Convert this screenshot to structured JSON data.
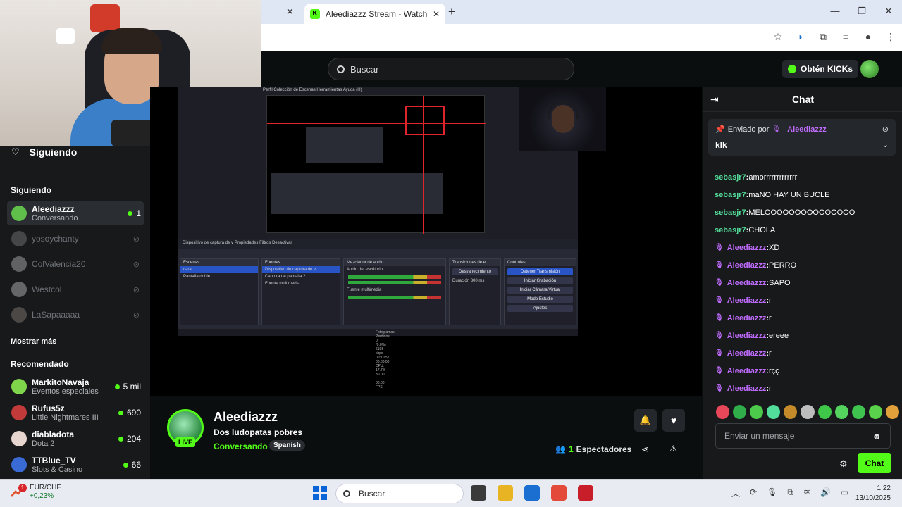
{
  "browser": {
    "tab_title": "Aleediazzz Stream - Watch Live",
    "tab_close": "✕",
    "prev_tab_close": "✕",
    "new_tab": "+",
    "window_controls": [
      "—",
      "❐",
      "✕"
    ],
    "toolbar_icons": [
      "star-icon",
      "audio-icon",
      "extensions-icon",
      "playlist-icon",
      "profile-icon",
      "menu-icon"
    ]
  },
  "header": {
    "search_placeholder": "Buscar",
    "kicks_label": "Obtén KICKs"
  },
  "sidebar": {
    "following_title": "Siguiendo",
    "following_section": "Siguiendo",
    "following": [
      {
        "name": "Aleediazzz",
        "sub": "Conversando",
        "viewers": "1",
        "live": true,
        "color": "#5fbf4a"
      },
      {
        "name": "yosoychanty",
        "sub": "",
        "viewers": "",
        "live": false,
        "color": "#8a8a8a"
      },
      {
        "name": "ColValencia20",
        "sub": "",
        "viewers": "",
        "live": false,
        "color": "#cfcfcf"
      },
      {
        "name": "Westcol",
        "sub": "",
        "viewers": "",
        "live": false,
        "color": "#d9d9d9"
      },
      {
        "name": "LaSapaaaaa",
        "sub": "",
        "viewers": "",
        "live": false,
        "color": "#9a8f85"
      }
    ],
    "show_more": "Mostrar más",
    "recommended_section": "Recomendado",
    "recommended": [
      {
        "name": "MarkitoNavaja",
        "sub": "Eventos especiales",
        "viewers": "5 mil",
        "color": "#7fd64a"
      },
      {
        "name": "Rufus5z",
        "sub": "Little Nightmares III",
        "viewers": "690",
        "color": "#c23a3a"
      },
      {
        "name": "diabladota",
        "sub": "Dota 2",
        "viewers": "204",
        "color": "#e6d6cf"
      },
      {
        "name": "TTBlue_TV",
        "sub": "Slots & Casino",
        "viewers": "66",
        "color": "#3a6ad6"
      }
    ]
  },
  "stream": {
    "streamer": "Aleediazzz",
    "title": "Dos ludopatas pobres",
    "category": "Conversando",
    "language": "Spanish",
    "live_badge": "LIVE",
    "viewer_count": "1",
    "viewer_label": "Espectadores"
  },
  "obs": {
    "menu": "Perfil    Colección de Escenas    Herramientas    Ayuda (H)",
    "toolbar": "Dispositivo de captura de v    Propiedades    Filtros    Desactivar",
    "panels": {
      "scenes_title": "Escenas",
      "scenes": [
        "cara",
        "Pantalla doble"
      ],
      "sources_title": "Fuentes",
      "sources": [
        "Dispositivo de captura de vi",
        "Captura de pantalla 2",
        "Fuente multimedia"
      ],
      "mixer_title": "Mezclador de audio",
      "mixer": [
        "Audio del escritorio",
        "Fuente multimedia"
      ],
      "transitions_title": "Transiciones de e...",
      "transition": "Desvanecimiento",
      "duration_label": "Duración",
      "duration": "300 ms",
      "controls_title": "Controles",
      "controls": [
        "Detener Transmisión",
        "Iniciar Grabación",
        "Iniciar Cámara Virtual",
        "Modo Estudio",
        "Ajustes"
      ]
    },
    "status": "Fotogramas Perdidos 0 (0.0%)   6198 kbps   00:10:52   00:00:00   CPU: 17.7%   30.00 / 30.00 FPS"
  },
  "chat": {
    "title": "Chat",
    "pinned_by_label": "Enviado por",
    "pinned_by": "Aleediazzz",
    "pinned_message": "klk",
    "messages": [
      {
        "user": "sebasjr7",
        "text": "amorrrrrrrrrrrrr",
        "color": "#53dd9a",
        "mic": false
      },
      {
        "user": "sebasjr7",
        "text": "maNO HAY UN BUCLE",
        "color": "#53dd9a",
        "mic": false
      },
      {
        "user": "sebasjr7",
        "text": "MELOOOOOOOOOOOOOOO",
        "color": "#53dd9a",
        "mic": false
      },
      {
        "user": "sebasjr7",
        "text": "CHOLA",
        "color": "#53dd9a",
        "mic": false
      },
      {
        "user": "Aleediazzz",
        "text": "XD",
        "color": "#c06cff",
        "mic": true
      },
      {
        "user": "Aleediazzz",
        "text": "PERRO",
        "color": "#c06cff",
        "mic": true
      },
      {
        "user": "Aleediazzz",
        "text": "SAPO",
        "color": "#c06cff",
        "mic": true
      },
      {
        "user": "Aleediazzz",
        "text": "r",
        "color": "#c06cff",
        "mic": true
      },
      {
        "user": "Aleediazzz",
        "text": "r",
        "color": "#c06cff",
        "mic": true
      },
      {
        "user": "Aleediazzz",
        "text": "ereee",
        "color": "#c06cff",
        "mic": true
      },
      {
        "user": "Aleediazzz",
        "text": "r",
        "color": "#c06cff",
        "mic": true
      },
      {
        "user": "Aleediazzz",
        "text": "rçç",
        "color": "#c06cff",
        "mic": true
      },
      {
        "user": "Aleediazzz",
        "text": "r",
        "color": "#c06cff",
        "mic": true
      }
    ],
    "emote_colors": [
      "#e8475a",
      "#2fae4a",
      "#4cc94a",
      "#53dd9a",
      "#c58a2a",
      "#bdbdbd",
      "#3fc74a",
      "#54d35e",
      "#3ec44f",
      "#5ad24b",
      "#e0a03a"
    ],
    "input_placeholder": "Enviar un mensaje",
    "send_label": "Chat"
  },
  "taskbar": {
    "ticker_label": "EUR/CHF",
    "ticker_change": "+0,23%",
    "weather_badge": "1",
    "search_placeholder": "Buscar",
    "app_colors": [
      "#3a3a3a",
      "#e8b423",
      "#1a6fd0",
      "#e44a3a",
      "#c81e2a"
    ],
    "tray_icons": [
      "︿",
      "⟳",
      "🎙",
      "⧉",
      "≋",
      "🔊",
      "▭"
    ],
    "time": "1:22",
    "date": "13/10/2025"
  },
  "colors": {
    "brand_green": "#53fc18",
    "bg": "#0b0e0f",
    "panel": "#18191b",
    "streamer_color": "#c06cff",
    "viewer_color": "#53dd9a"
  }
}
